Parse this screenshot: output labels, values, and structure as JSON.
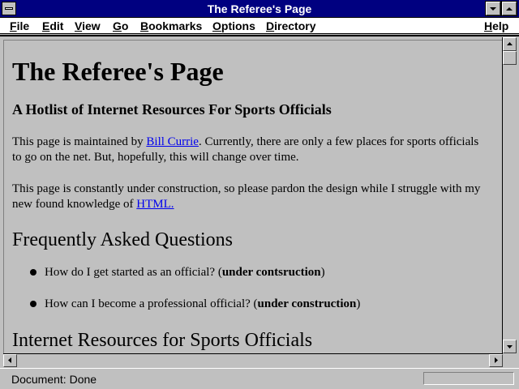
{
  "window": {
    "title": "The Referee's Page"
  },
  "menu": {
    "items": [
      {
        "label": "File",
        "underline": "F",
        "rest": "ile"
      },
      {
        "label": "Edit",
        "underline": "E",
        "rest": "dit"
      },
      {
        "label": "View",
        "underline": "V",
        "rest": "iew"
      },
      {
        "label": "Go",
        "underline": "G",
        "rest": "o"
      },
      {
        "label": "Bookmarks",
        "underline": "B",
        "rest": "ookmarks"
      },
      {
        "label": "Options",
        "underline": "O",
        "rest": "ptions"
      },
      {
        "label": "Directory",
        "underline": "D",
        "rest": "irectory"
      }
    ],
    "help": {
      "label": "Help",
      "underline": "H",
      "rest": "elp"
    }
  },
  "page": {
    "heading": "The Referee's Page",
    "subheading": "A Hotlist of Internet Resources For Sports Officials",
    "para1": {
      "before": "This page is maintained by ",
      "link": "Bill Currie",
      "after": ". Currently, there are only a few places for sports officials to go on the net. But, hopefully, this will change over time."
    },
    "para2": {
      "before": "This page is constantly under construction, so please pardon the design while I struggle with my new found knowledge of ",
      "link": "HTML."
    },
    "faq_heading": "Frequently Asked Questions",
    "faq_items": [
      {
        "text": "How do I get started as an official? (",
        "bold": "under contsruction",
        "close": ")"
      },
      {
        "text": "How can I become a professional official? (",
        "bold": "under construction",
        "close": ")"
      }
    ],
    "resources_heading": "Internet Resources for Sports Officials"
  },
  "status": {
    "text": "Document: Done",
    "progress_fraction": 0
  }
}
